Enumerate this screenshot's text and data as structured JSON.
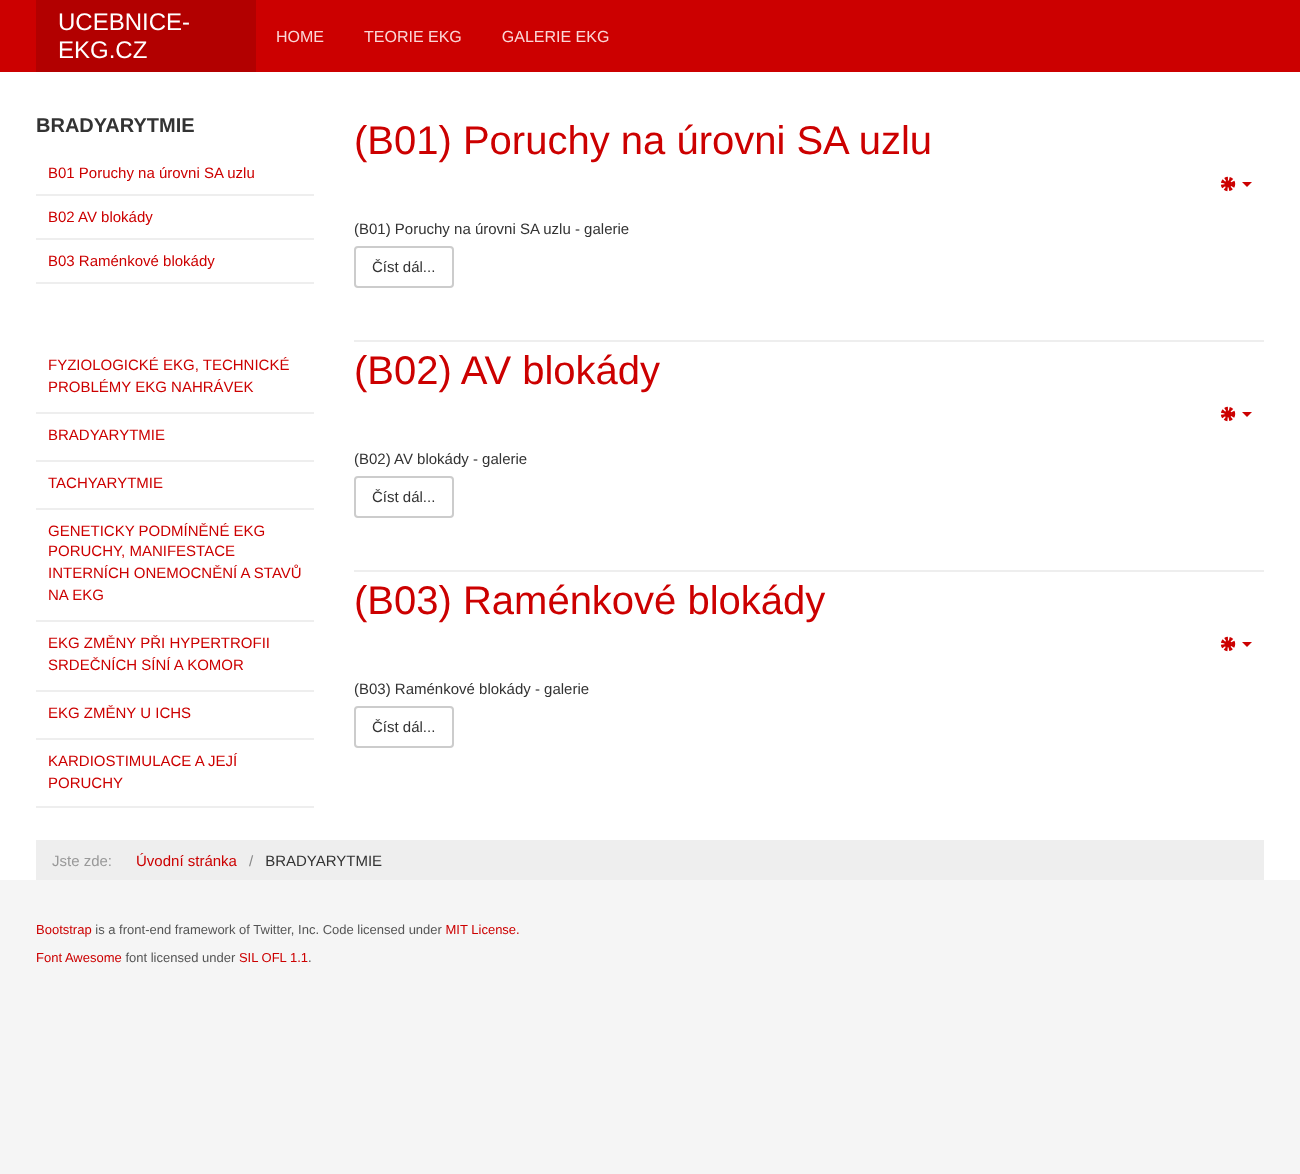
{
  "navbar": {
    "brand": "UCEBNICE-EKG.CZ",
    "items": [
      "HOME",
      "TEORIE EKG",
      "GALERIE EKG"
    ]
  },
  "sidebar": {
    "title": "BRADYARYTMIE",
    "submenu": [
      "B01 Poruchy na úrovni SA uzlu",
      "B02 AV blokády",
      "B03 Raménkové blokády"
    ],
    "categories": [
      "FYZIOLOGICKÉ EKG, TECHNICKÉ PROBLÉMY EKG NAHRÁVEK",
      "BRADYARYTMIE",
      "TACHYARYTMIE",
      "GENETICKY PODMÍNĚNÉ EKG PORUCHY, MANIFESTACE INTERNÍCH ONEMOCNĚNÍ A STAVŮ NA EKG",
      "EKG ZMĚNY PŘI HYPERTROFII SRDEČNÍCH SÍNÍ A KOMOR",
      "EKG ZMĚNY U ICHS",
      "KARDIOSTIMULACE A JEJÍ PORUCHY"
    ]
  },
  "articles": [
    {
      "title": "(B01) Poruchy na úrovni SA uzlu",
      "intro": "(B01) Poruchy na úrovni SA uzlu - galerie",
      "button": "Číst dál..."
    },
    {
      "title": "(B02) AV blokády",
      "intro": "(B02) AV blokády - galerie",
      "button": "Číst dál..."
    },
    {
      "title": "(B03) Raménkové blokády",
      "intro": "(B03) Raménkové blokády - galerie",
      "button": "Číst dál..."
    }
  ],
  "breadcrumb": {
    "label": "Jste zde:",
    "items": [
      {
        "text": "Úvodní stránka",
        "kind": "link"
      },
      {
        "text": "/",
        "kind": "separator"
      },
      {
        "text": "BRADYARYTMIE",
        "kind": "current"
      }
    ]
  },
  "footer": [
    [
      {
        "text": "Bootstrap",
        "kind": "link"
      },
      {
        "text": "is a front-end framework of Twitter, Inc. Code licensed under",
        "kind": "text"
      },
      {
        "text": "MIT License.",
        "kind": "link"
      }
    ],
    [
      {
        "text": "Font Awesome",
        "kind": "link"
      },
      {
        "text": "font licensed under",
        "kind": "text"
      },
      {
        "text": "SIL OFL 1.1",
        "kind": "link"
      },
      {
        "text": ".",
        "kind": "text"
      }
    ]
  ]
}
